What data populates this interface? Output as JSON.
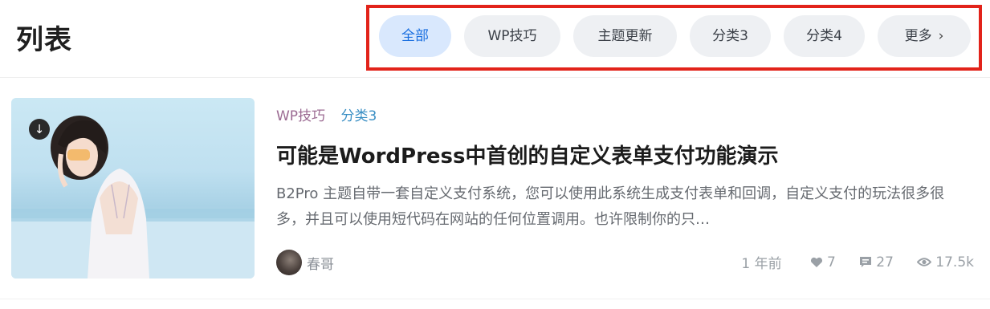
{
  "page": {
    "title": "列表"
  },
  "filters": {
    "tabs": [
      {
        "label": "全部",
        "active": true
      },
      {
        "label": "WP技巧",
        "active": false
      },
      {
        "label": "主题更新",
        "active": false
      },
      {
        "label": "分类3",
        "active": false
      },
      {
        "label": "分类4",
        "active": false
      }
    ],
    "more": {
      "label": "更多",
      "icon": "chevron-right-icon"
    },
    "colors": {
      "active_bg": "#d9e8fd",
      "active_text": "#1a6fe0",
      "highlight_border": "#e2231a"
    }
  },
  "post": {
    "categories": [
      {
        "label": "WP技巧",
        "color": "#9b6a92"
      },
      {
        "label": "分类3",
        "color": "#3a8fc4"
      }
    ],
    "title": "可能是WordPress中首创的自定义表单支付功能演示",
    "excerpt": "B2Pro 主题自带一套自定义支付系统，您可以使用此系统生成支付表单和回调，自定义支付的玩法很多很多，并且可以使用短代码在网站的任何位置调用。也许限制你的只…",
    "author": "春哥",
    "time": "1 年前",
    "likes": "7",
    "comments": "27",
    "views": "17.5k",
    "thumbnail_icon": "download-icon"
  }
}
